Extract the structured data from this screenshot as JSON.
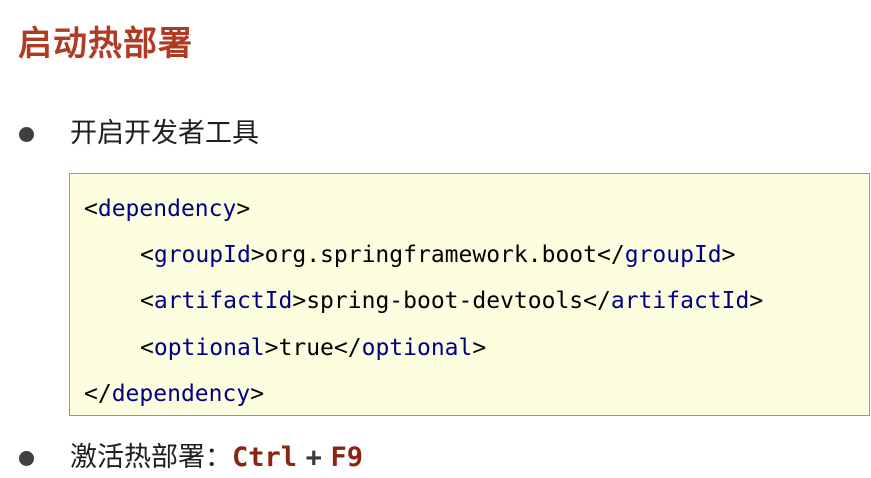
{
  "title": "启动热部署",
  "bullets": {
    "first": "开启开发者工具",
    "second_prefix": "激活热部署：",
    "key_ctrl": "Ctrl",
    "key_plus": "+",
    "key_f9": "F9"
  },
  "code": {
    "lines": [
      {
        "open": "<",
        "tag": "dependency",
        "close": ">"
      },
      {
        "open": "<",
        "tag": "groupId",
        "close": ">",
        "value": "org.springframework.boot",
        "end_open": "</",
        "end_tag": "groupId",
        "end_close": ">"
      },
      {
        "open": "<",
        "tag": "artifactId",
        "close": ">",
        "value": "spring-boot-devtools",
        "end_open": "</",
        "end_tag": "artifactId",
        "end_close": ">"
      },
      {
        "open": "<",
        "tag": "optional",
        "close": ">",
        "value": "true",
        "end_open": "</",
        "end_tag": "optional",
        "end_close": ">"
      },
      {
        "open": "</",
        "tag": "dependency",
        "close": ">"
      }
    ]
  },
  "colors": {
    "title": "#b03a22",
    "code_background": "#fdfde0",
    "tag_name": "#000080",
    "shortcut": "#8b2512"
  },
  "icons": {
    "bullet": "bullet-dot-icon"
  }
}
